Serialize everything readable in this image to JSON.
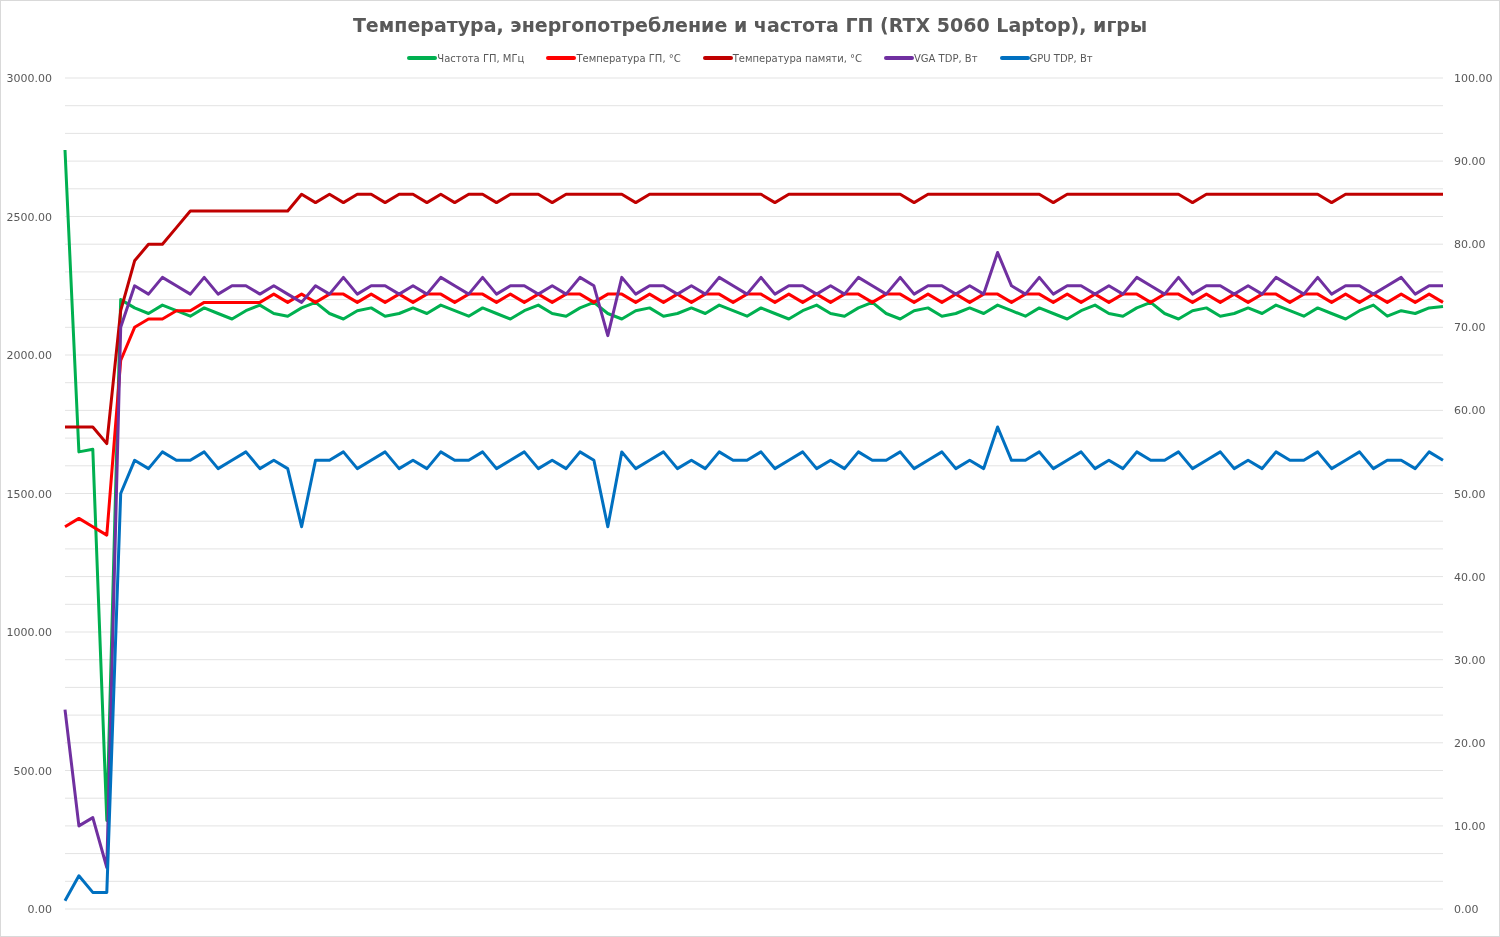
{
  "chart_data": {
    "type": "line",
    "title": "Температура,  энергопотребление и частота ГП (RTX 5060 Laptop), игры",
    "grid": true,
    "legend": "top",
    "ylim": [
      0,
      3000
    ],
    "yticks": [
      {
        "value": 0,
        "label": "0.00"
      },
      {
        "value": 500,
        "label": "500.00"
      },
      {
        "value": 1000,
        "label": "1000.00"
      },
      {
        "value": 1500,
        "label": "1500.00"
      },
      {
        "value": 2000,
        "label": "2000.00"
      },
      {
        "value": 2500,
        "label": "2500.00"
      },
      {
        "value": 3000,
        "label": "3000.00"
      }
    ],
    "y2lim": [
      0,
      100
    ],
    "y2ticks": [
      {
        "value": 0,
        "label": "0.00"
      },
      {
        "value": 10,
        "label": "10.00"
      },
      {
        "value": 20,
        "label": "20.00"
      },
      {
        "value": 30,
        "label": "30.00"
      },
      {
        "value": 40,
        "label": "40.00"
      },
      {
        "value": 50,
        "label": "50.00"
      },
      {
        "value": 60,
        "label": "60.00"
      },
      {
        "value": 70,
        "label": "70.00"
      },
      {
        "value": 80,
        "label": "80.00"
      },
      {
        "value": 90,
        "label": "90.00"
      },
      {
        "value": 100,
        "label": "100.00"
      }
    ],
    "series": [
      {
        "name": "Частота ГП, МГц",
        "color": "#00b050",
        "values": [
          2740,
          1650,
          1660,
          320,
          2200,
          2170,
          2150,
          2180,
          2160,
          2140,
          2170,
          2150,
          2130,
          2160,
          2180,
          2150,
          2140,
          2170,
          2190,
          2150,
          2130,
          2160,
          2170,
          2140,
          2150,
          2170,
          2150,
          2180,
          2160,
          2140,
          2170,
          2150,
          2130,
          2160,
          2180,
          2150,
          2140,
          2170,
          2190,
          2150,
          2130,
          2160,
          2170,
          2140,
          2150,
          2170,
          2150,
          2180,
          2160,
          2140,
          2170,
          2150,
          2130,
          2160,
          2180,
          2150,
          2140,
          2170,
          2190,
          2150,
          2130,
          2160,
          2170,
          2140,
          2150,
          2170,
          2150,
          2180,
          2160,
          2140,
          2170,
          2150,
          2130,
          2160,
          2180,
          2150,
          2140,
          2170,
          2190,
          2150,
          2130,
          2160,
          2170,
          2140,
          2150,
          2170,
          2150,
          2180,
          2160,
          2140,
          2170,
          2150,
          2130,
          2160,
          2180,
          2140,
          2160,
          2150,
          2170,
          2175
        ]
      },
      {
        "name": "Температура ГП, °C",
        "color": "#ff0000",
        "axis": "y2",
        "values": [
          46,
          47,
          46,
          45,
          66,
          70,
          71,
          71,
          72,
          72,
          73,
          73,
          73,
          73,
          73,
          74,
          73,
          74,
          73,
          74,
          74,
          73,
          74,
          73,
          74,
          73,
          74,
          74,
          73,
          74,
          74,
          73,
          74,
          73,
          74,
          73,
          74,
          74,
          73,
          74,
          74,
          73,
          74,
          73,
          74,
          73,
          74,
          74,
          73,
          74,
          74,
          73,
          74,
          73,
          74,
          73,
          74,
          74,
          73,
          74,
          74,
          73,
          74,
          73,
          74,
          73,
          74,
          74,
          73,
          74,
          74,
          73,
          74,
          73,
          74,
          73,
          74,
          74,
          73,
          74,
          74,
          73,
          74,
          73,
          74,
          73,
          74,
          74,
          73,
          74,
          74,
          73,
          74,
          73,
          74,
          73,
          74,
          73,
          74,
          73
        ]
      },
      {
        "name": "Температура памяти, °C",
        "color": "#c00000",
        "axis": "y2",
        "values": [
          58,
          58,
          58,
          56,
          72,
          78,
          80,
          80,
          82,
          84,
          84,
          84,
          84,
          84,
          84,
          84,
          84,
          86,
          85,
          86,
          85,
          86,
          86,
          85,
          86,
          86,
          85,
          86,
          85,
          86,
          86,
          85,
          86,
          86,
          86,
          85,
          86,
          86,
          86,
          86,
          86,
          85,
          86,
          86,
          86,
          86,
          86,
          86,
          86,
          86,
          86,
          85,
          86,
          86,
          86,
          86,
          86,
          86,
          86,
          86,
          86,
          85,
          86,
          86,
          86,
          86,
          86,
          86,
          86,
          86,
          86,
          85,
          86,
          86,
          86,
          86,
          86,
          86,
          86,
          86,
          86,
          85,
          86,
          86,
          86,
          86,
          86,
          86,
          86,
          86,
          86,
          85,
          86,
          86,
          86,
          86,
          86,
          86,
          86,
          86
        ]
      },
      {
        "name": "VGA TDP, Вт",
        "color": "#7030a0",
        "axis": "y2",
        "values": [
          24,
          10,
          11,
          5,
          70,
          75,
          74,
          76,
          75,
          74,
          76,
          74,
          75,
          75,
          74,
          75,
          74,
          73,
          75,
          74,
          76,
          74,
          75,
          75,
          74,
          75,
          74,
          76,
          75,
          74,
          76,
          74,
          75,
          75,
          74,
          75,
          74,
          76,
          75,
          69,
          76,
          74,
          75,
          75,
          74,
          75,
          74,
          76,
          75,
          74,
          76,
          74,
          75,
          75,
          74,
          75,
          74,
          76,
          75,
          74,
          76,
          74,
          75,
          75,
          74,
          75,
          74,
          79,
          75,
          74,
          76,
          74,
          75,
          75,
          74,
          75,
          74,
          76,
          75,
          74,
          76,
          74,
          75,
          75,
          74,
          75,
          74,
          76,
          75,
          74,
          76,
          74,
          75,
          75,
          74,
          75,
          76,
          74,
          75,
          75
        ]
      },
      {
        "name": "GPU TDP, Вт",
        "color": "#0070c0",
        "axis": "y2",
        "values": [
          1,
          4,
          2,
          2,
          50,
          54,
          53,
          55,
          54,
          54,
          55,
          53,
          54,
          55,
          53,
          54,
          53,
          46,
          54,
          54,
          55,
          53,
          54,
          55,
          53,
          54,
          53,
          55,
          54,
          54,
          55,
          53,
          54,
          55,
          53,
          54,
          53,
          55,
          54,
          46,
          55,
          53,
          54,
          55,
          53,
          54,
          53,
          55,
          54,
          54,
          55,
          53,
          54,
          55,
          53,
          54,
          53,
          55,
          54,
          54,
          55,
          53,
          54,
          55,
          53,
          54,
          53,
          58,
          54,
          54,
          55,
          53,
          54,
          55,
          53,
          54,
          53,
          55,
          54,
          54,
          55,
          53,
          54,
          55,
          53,
          54,
          53,
          55,
          54,
          54,
          55,
          53,
          54,
          55,
          53,
          54,
          54,
          53,
          55,
          54
        ]
      }
    ]
  }
}
